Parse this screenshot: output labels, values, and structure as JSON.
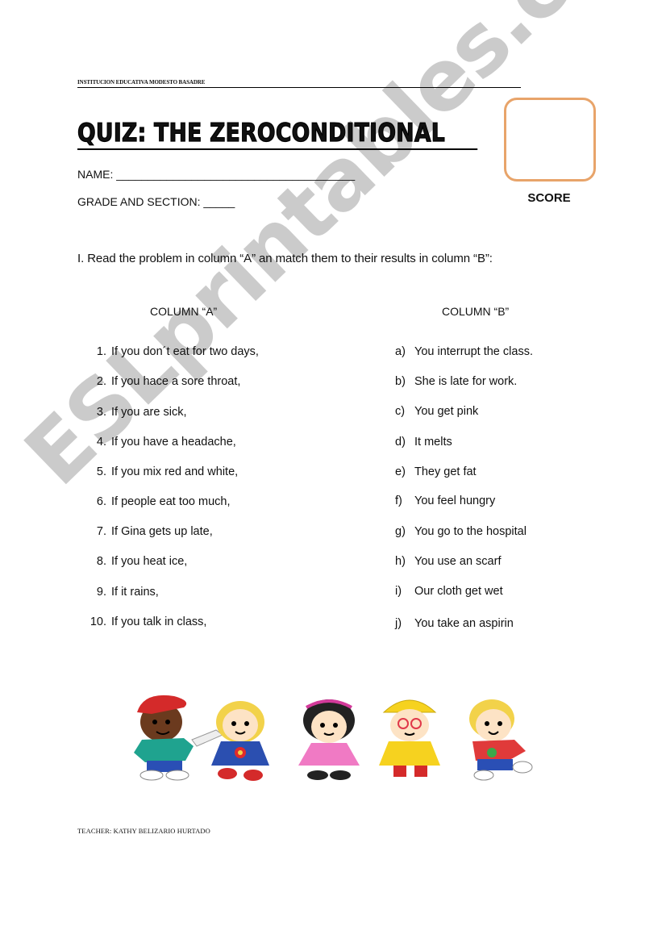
{
  "header": {
    "school": "INSTITUCION EDUCATIVA MODESTO BASADRE",
    "title": "QUIZ: THE ZEROCONDITIONAL"
  },
  "fields": {
    "name_label": "NAME:",
    "name_blank": "______________________________________",
    "grade_label": "GRADE AND SECTION:",
    "grade_blank": "_____"
  },
  "score": {
    "label": "SCORE",
    "box_color": "#e8a46a"
  },
  "instruction": "I.  Read the problem in column “A” an match them to their results in column “B”:",
  "columns": {
    "a_header": "COLUMN “A”",
    "b_header": "COLUMN “B”",
    "a_items": [
      {
        "num": "1.",
        "text": "If you don´t eat for two days,"
      },
      {
        "num": "2.",
        "text": "If you hace a sore throat,"
      },
      {
        "num": "3.",
        "text": "If you are sick,"
      },
      {
        "num": "4.",
        "text": "If you have a headache,"
      },
      {
        "num": "5.",
        "text": "If you mix red and white,"
      },
      {
        "num": "6.",
        "text": "If people eat too much,"
      },
      {
        "num": "7.",
        "text": "If Gina gets up late,"
      },
      {
        "num": "8.",
        "text": "If you heat ice,"
      },
      {
        "num": "9.",
        "text": "If it rains,"
      },
      {
        "num": "10.",
        "text": "If you talk in class,"
      }
    ],
    "b_items": [
      {
        "letter": "a)",
        "text": "You interrupt the class."
      },
      {
        "letter": "b)",
        "text": "She is late for work."
      },
      {
        "letter": "c)",
        "text": "You get pink"
      },
      {
        "letter": "d)",
        "text": "It melts"
      },
      {
        "letter": "e)",
        "text": "They get fat"
      },
      {
        "letter": "f)",
        "text": "You feel hungry"
      },
      {
        "letter": "g)",
        "text": "You go to the hospital"
      },
      {
        "letter": "h)",
        "text": "You use an scarf"
      },
      {
        "letter": "i)",
        "text": "Our cloth get wet"
      },
      {
        "letter": "j)",
        "text": "You take an aspirin"
      }
    ]
  },
  "illustration": {
    "description": "five cartoon children holding hands",
    "children": [
      "boy-red-cap-green-sweater",
      "girl-blonde-blue-dress",
      "girl-black-hair-pink-dress",
      "girl-yellow-raincoat-glasses",
      "boy-blonde-red-shirt"
    ]
  },
  "watermark": "ESLprintables.com",
  "footer": {
    "teacher": "TEACHER: KATHY BELIZARIO HURTADO"
  }
}
